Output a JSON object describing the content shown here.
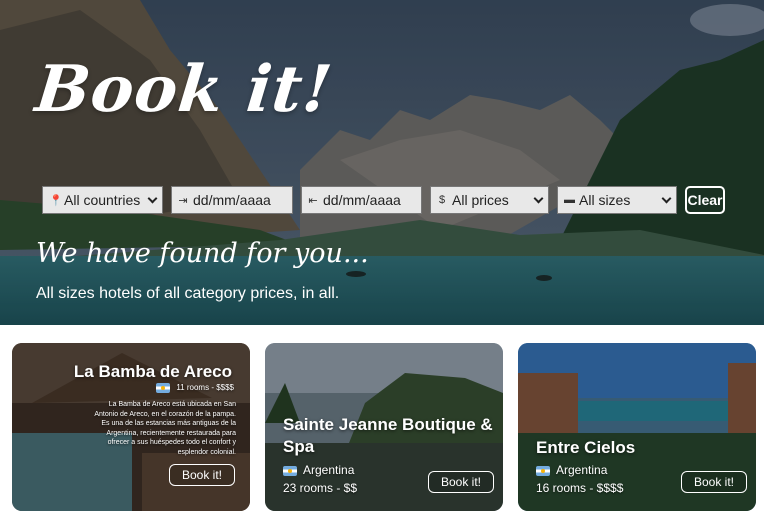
{
  "hero": {
    "title": "Book it!",
    "found_text": "We have found for you...",
    "subtitle": "All sizes hotels of all category prices, in all."
  },
  "filters": {
    "country": {
      "icon": "map-pin-icon",
      "value": "All countries"
    },
    "checkin": {
      "icon": "checkin-icon",
      "placeholder": "dd/mm/aaaa"
    },
    "checkout": {
      "icon": "checkout-icon",
      "placeholder": "dd/mm/aaaa"
    },
    "price": {
      "icon": "dollar-icon",
      "value": "All prices"
    },
    "size": {
      "icon": "bed-icon",
      "value": "All sizes"
    },
    "clear_label": "Clear"
  },
  "hotels": [
    {
      "name": "La Bamba de Areco",
      "rooms": "11 rooms",
      "price": "$$$$",
      "description": "La Bamba de Areco está ubicada en San Antonio de Areco, en el corazón de la pampa. Es una de las estancias más antiguas de la Argentina, recientemente restaurada para ofrecer a sus huéspedes todo el confort y esplendor colonial.",
      "book_label": "Book it!"
    },
    {
      "name": "Sainte Jeanne Boutique & Spa",
      "country": "Argentina",
      "rooms_price": "23 rooms - $$",
      "book_label": "Book it!"
    },
    {
      "name": "Entre Cielos",
      "country": "Argentina",
      "rooms_price": "16 rooms - $$$$",
      "book_label": "Book it!"
    }
  ],
  "colors": {
    "hero_sky": "#3b4b5e",
    "lake": "#2a6a70",
    "filter_bg": "#e8e8e8"
  }
}
